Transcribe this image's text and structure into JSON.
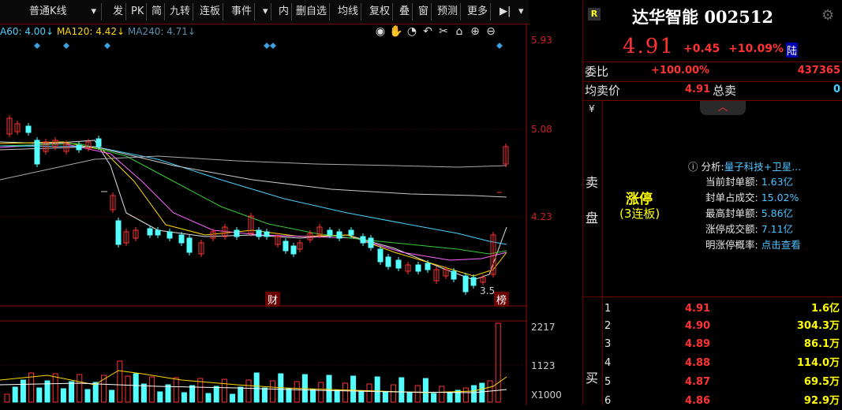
{
  "toolbar": {
    "period": "普通K线",
    "buttons": [
      "发",
      "PK",
      "简",
      "九转",
      "连板",
      "事件",
      "内",
      "删自选",
      "均线",
      "复权",
      "叠",
      "窗",
      "预测",
      "更多"
    ]
  },
  "ma": {
    "ma60": "A60: 4.00↓",
    "ma120": "MA120: 4.42↓",
    "ma240": "MA240: 4.71↓"
  },
  "price_axis": [
    "5.93",
    "5.08",
    "4.23"
  ],
  "volume_axis": [
    "2217",
    "1123",
    "X1000"
  ],
  "chart_markers": {
    "cai": "财",
    "bang": "榜",
    "low": "3.5"
  },
  "stock": {
    "badge": "R",
    "name": "达华智能",
    "code": "002512",
    "price": "4.91",
    "change": "+0.45",
    "change_pct": "+10.09%",
    "lu": "陆"
  },
  "weibi": {
    "label": "委比",
    "pct": "+100.00%",
    "value": "437365"
  },
  "junmai": {
    "label": "均卖价",
    "price": "4.91",
    "total_label": "总卖",
    "total": "0"
  },
  "yen": "¥",
  "sell_label": [
    "卖",
    "盘"
  ],
  "limit": {
    "title": "涨停",
    "sub": "(3连板)"
  },
  "analysis": {
    "head_label": "分析:",
    "head_value": "量子科技+卫星...",
    "rows": [
      {
        "k": "当前封单额:",
        "v": "1.63亿"
      },
      {
        "k": "封单占成交:",
        "v": "15.02%"
      },
      {
        "k": "最高封单额:",
        "v": "5.86亿"
      },
      {
        "k": "涨停成交额:",
        "v": "7.11亿"
      },
      {
        "k": "明涨停概率:",
        "v": "点击查看"
      }
    ]
  },
  "buy_label": "买",
  "bids": [
    {
      "n": "1",
      "p": "4.91",
      "v": "1.6亿"
    },
    {
      "n": "2",
      "p": "4.90",
      "v": "304.3万"
    },
    {
      "n": "3",
      "p": "4.89",
      "v": "86.1万"
    },
    {
      "n": "4",
      "p": "4.88",
      "v": "114.0万"
    },
    {
      "n": "5",
      "p": "4.87",
      "v": "69.5万"
    },
    {
      "n": "6",
      "p": "4.86",
      "v": "92.9万"
    }
  ]
}
